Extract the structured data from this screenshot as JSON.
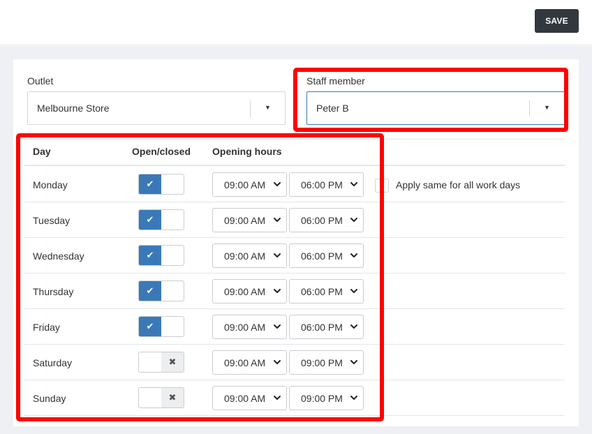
{
  "toolbar": {
    "save_label": "SAVE"
  },
  "outlet": {
    "label": "Outlet",
    "value": "Melbourne Store"
  },
  "staff": {
    "label": "Staff member",
    "value": "Peter B"
  },
  "table": {
    "headers": {
      "day": "Day",
      "open_closed": "Open/closed",
      "hours": "Opening hours"
    },
    "apply_same_label": "Apply same for all work days",
    "rows": [
      {
        "day": "Monday",
        "open": true,
        "start": "09:00 AM",
        "end": "06:00 PM"
      },
      {
        "day": "Tuesday",
        "open": true,
        "start": "09:00 AM",
        "end": "06:00 PM"
      },
      {
        "day": "Wednesday",
        "open": true,
        "start": "09:00 AM",
        "end": "06:00 PM"
      },
      {
        "day": "Thursday",
        "open": true,
        "start": "09:00 AM",
        "end": "06:00 PM"
      },
      {
        "day": "Friday",
        "open": true,
        "start": "09:00 AM",
        "end": "06:00 PM"
      },
      {
        "day": "Saturday",
        "open": false,
        "start": "09:00 AM",
        "end": "09:00 PM"
      },
      {
        "day": "Sunday",
        "open": false,
        "start": "09:00 AM",
        "end": "09:00 PM"
      }
    ]
  },
  "icons": {
    "check": "✔",
    "cross": "✖",
    "caret": "▼"
  },
  "colors": {
    "accent": "#3a79b8",
    "highlight": "#ff0000",
    "save_bg": "#33383e"
  }
}
